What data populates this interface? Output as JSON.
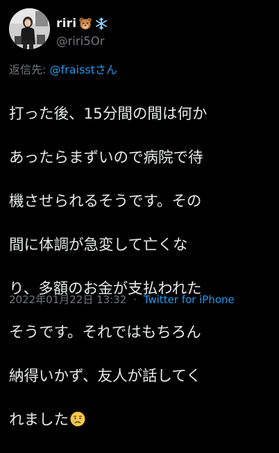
{
  "user": {
    "display_name": "riri",
    "handle": "@riri5Or",
    "name_emojis": [
      "bear-face-emoji",
      "snowflake-emoji"
    ]
  },
  "reply": {
    "prefix": "返信先:",
    "target": "@fraisstさん"
  },
  "tweet": {
    "lines": [
      "打った後、15分間の間は何か",
      "あったらまずいので病院で待",
      "機させられるそうです。その",
      "間に体調が急変して亡くな",
      "り、多額のお金が支払われた",
      "そうです。それではもちろん",
      "納得いかず、友人が話してく",
      "れました"
    ],
    "trailing_emoji": "crying-face-emoji"
  },
  "footer": {
    "timestamp": "2022年01月22日 13:32",
    "separator": "·",
    "source": "Twitter for iPhone"
  },
  "colors": {
    "background": "#000000",
    "text": "#e7e9ea",
    "secondary": "#71767b",
    "link": "#1d9bf0"
  }
}
